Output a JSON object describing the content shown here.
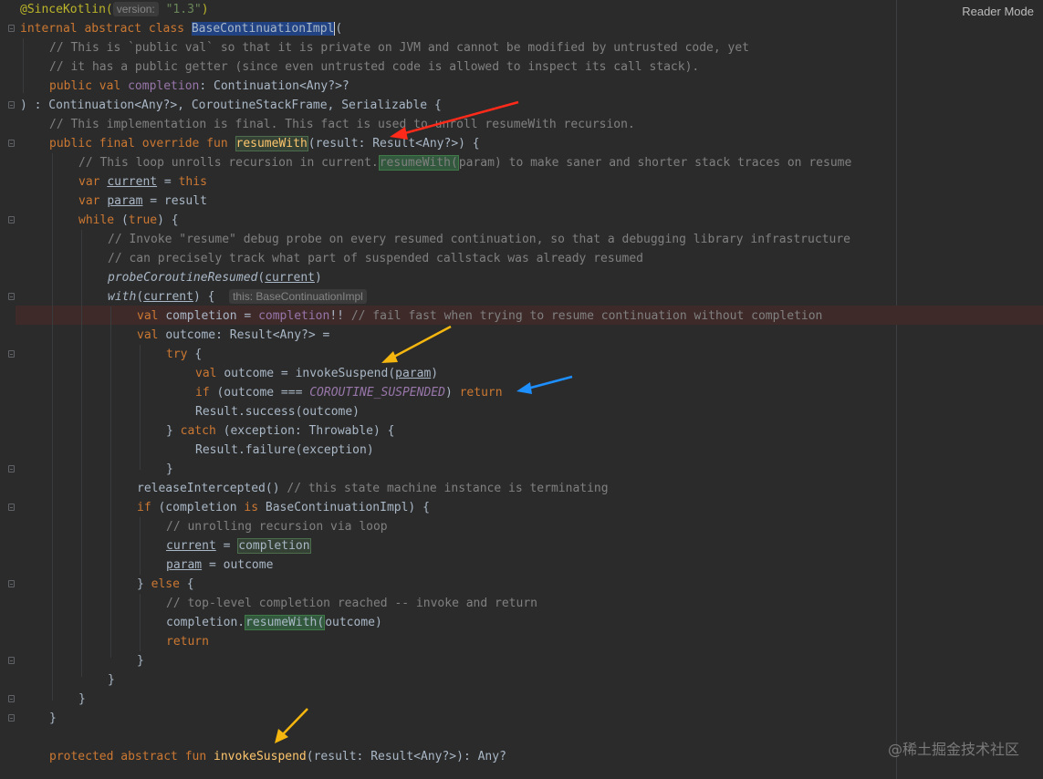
{
  "toolbar": {
    "reader_mode": "Reader Mode"
  },
  "watermark": "@稀土掘金技术社区",
  "code": {
    "l1_ann": "@SinceKotlin(",
    "l1_hint": "version:",
    "l1_str": "\"1.3\"",
    "l1_close": ")",
    "l2_kw": "internal abstract class ",
    "l2_cls": "BaseContinuationImpl",
    "l2_paren": "(",
    "l3": "// This is `public val` so that it is private on JVM and cannot be modified by untrusted code, yet",
    "l4": "// it has a public getter (since even untrusted code is allowed to inspect its call stack).",
    "l5_kw": "public val ",
    "l5_prop": "completion",
    "l5_rest": ": Continuation<Any?>?",
    "l6": ") : Continuation<Any?>, CoroutineStackFrame, Serializable {",
    "l7": "// This implementation is final. This fact is used to unroll resumeWith recursion.",
    "l8_kw": "public final override fun ",
    "l8_fn": "resumeWith",
    "l8_rest": "(result: Result<Any?>) {",
    "l9_a": "// This loop unrolls recursion in current.",
    "l9_b": "resumeWith(",
    "l9_c": "param) to make saner and shorter stack traces on resume",
    "l10_kw": "var ",
    "l10_var": "current",
    "l10_eq": " = ",
    "l10_this": "this",
    "l11_kw": "var ",
    "l11_var": "param",
    "l11_rest": " = result",
    "l12_kw": "while ",
    "l12_p1": "(",
    "l12_true": "true",
    "l12_p2": ") {",
    "l13": "// Invoke \"resume\" debug probe on every resumed continuation, so that a debugging library infrastructure",
    "l14": "// can precisely track what part of suspended callstack was already resumed",
    "l15_fn": "probeCoroutineResumed",
    "l15_p1": "(",
    "l15_var": "current",
    "l15_p2": ")",
    "l16_fn": "with",
    "l16_p1": "(",
    "l16_var": "current",
    "l16_p2": ") {  ",
    "l16_hint": "this: BaseContinuationImpl",
    "l17_kw": "val ",
    "l17_a": "completion = ",
    "l17_prop": "completion",
    "l17_b": "!! ",
    "l17_cm": "// fail fast when trying to resume continuation without completion",
    "l18_kw": "val ",
    "l18_rest": "outcome: Result<Any?> =",
    "l19_kw": "try ",
    "l19_rest": "{",
    "l20_kw": "val ",
    "l20_a": "outcome = invokeSuspend(",
    "l20_var": "param",
    "l20_b": ")",
    "l21_kw": "if ",
    "l21_a": "(outcome === ",
    "l21_cst": "COROUTINE_SUSPENDED",
    "l21_b": ") ",
    "l21_ret": "return",
    "l22": "Result.success(outcome)",
    "l23_a": "} ",
    "l23_kw": "catch ",
    "l23_b": "(exception: Throwable) {",
    "l24": "Result.failure(exception)",
    "l25": "}",
    "l26_a": "releaseIntercepted() ",
    "l26_cm": "// this state machine instance is terminating",
    "l27_kw": "if ",
    "l27_a": "(completion ",
    "l27_is": "is ",
    "l27_b": "BaseContinuationImpl) {",
    "l28": "// unrolling recursion via loop",
    "l29_var": "current",
    "l29_eq": " = ",
    "l29_comp": "completion",
    "l30_var": "param",
    "l30_rest": " = outcome",
    "l31_a": "} ",
    "l31_kw": "else ",
    "l31_b": "{",
    "l32": "// top-level completion reached -- invoke and return",
    "l33_a": "completion.",
    "l33_fn": "resumeWith(",
    "l33_b": "outcome)",
    "l34": "return",
    "l35": "}",
    "l36": "}",
    "l37": "}",
    "l38": "}",
    "l40_kw": "protected abstract fun ",
    "l40_fn": "invokeSuspend",
    "l40_rest": "(result: Result<Any?>): Any?"
  },
  "colors": {
    "background": "#2b2b2b",
    "keyword": "#cc7832",
    "comment": "#808080",
    "string": "#6a8759",
    "annotation": "#bbb529",
    "property": "#9876aa",
    "function": "#ffc66d",
    "arrow_red": "#ff2a1a",
    "arrow_yellow": "#f5b70f",
    "arrow_blue": "#1e8fff"
  }
}
